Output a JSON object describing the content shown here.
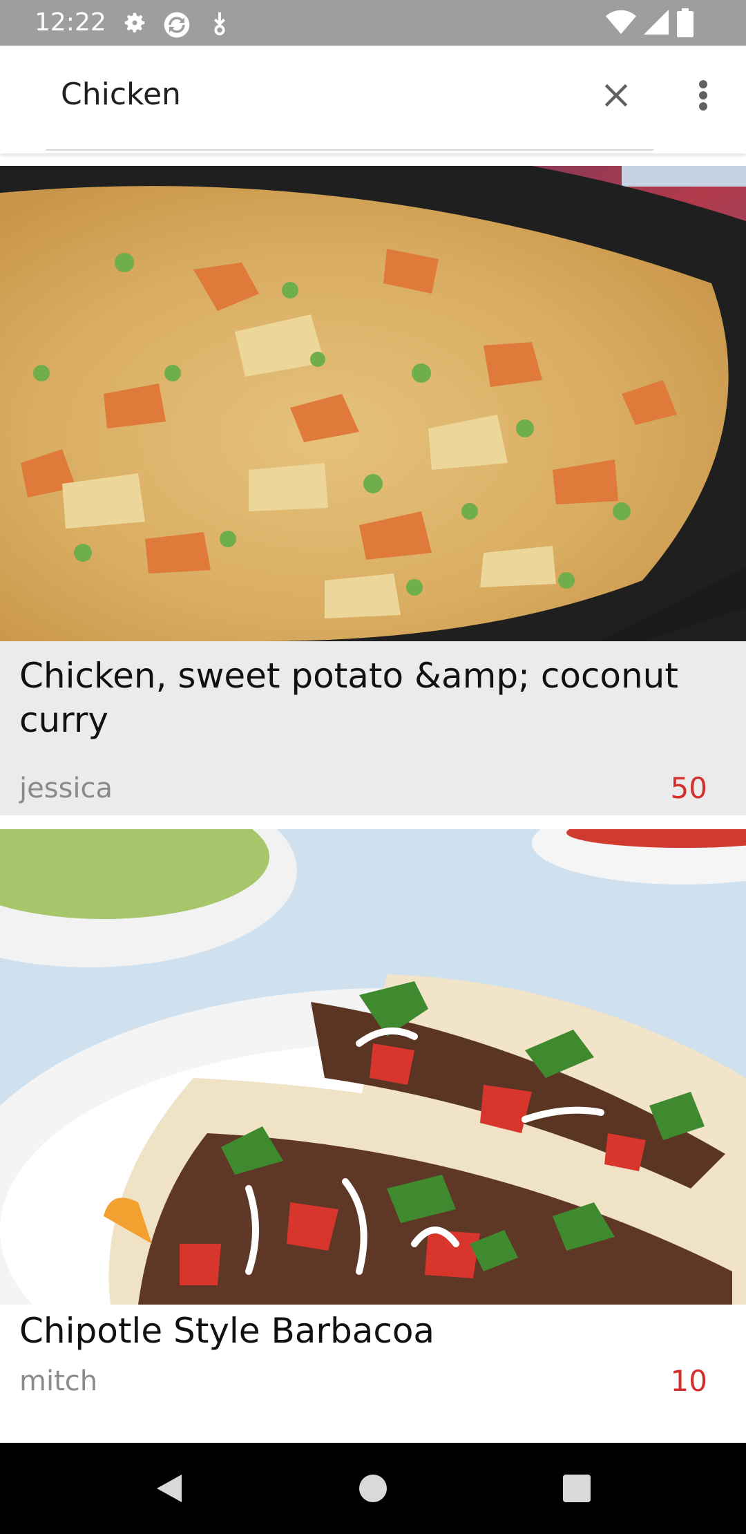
{
  "status_bar": {
    "time": "12:22",
    "left_icons": [
      "gear-icon",
      "sync-icon",
      "download-icon"
    ],
    "right_icons": [
      "wifi-icon",
      "signal-icon",
      "battery-icon"
    ]
  },
  "search": {
    "query": "Chicken",
    "clear_icon": "close-icon",
    "menu_icon": "more-vert-icon"
  },
  "recipes": [
    {
      "title": "Chicken, sweet potato &amp; coconut curry",
      "author": "jessica",
      "score": "50",
      "image": "chicken-curry-photo"
    },
    {
      "title": "Chipotle Style Barbacoa",
      "author": "mitch",
      "score": "10",
      "image": "barbacoa-tacos-photo"
    }
  ],
  "nav": {
    "back_icon": "back-triangle-icon",
    "home_icon": "home-circle-icon",
    "recents_icon": "recents-square-icon"
  },
  "colors": {
    "accent_score": "#d32f2f",
    "status_bar": "#9e9e9e",
    "selected_card": "#ebebeb"
  }
}
